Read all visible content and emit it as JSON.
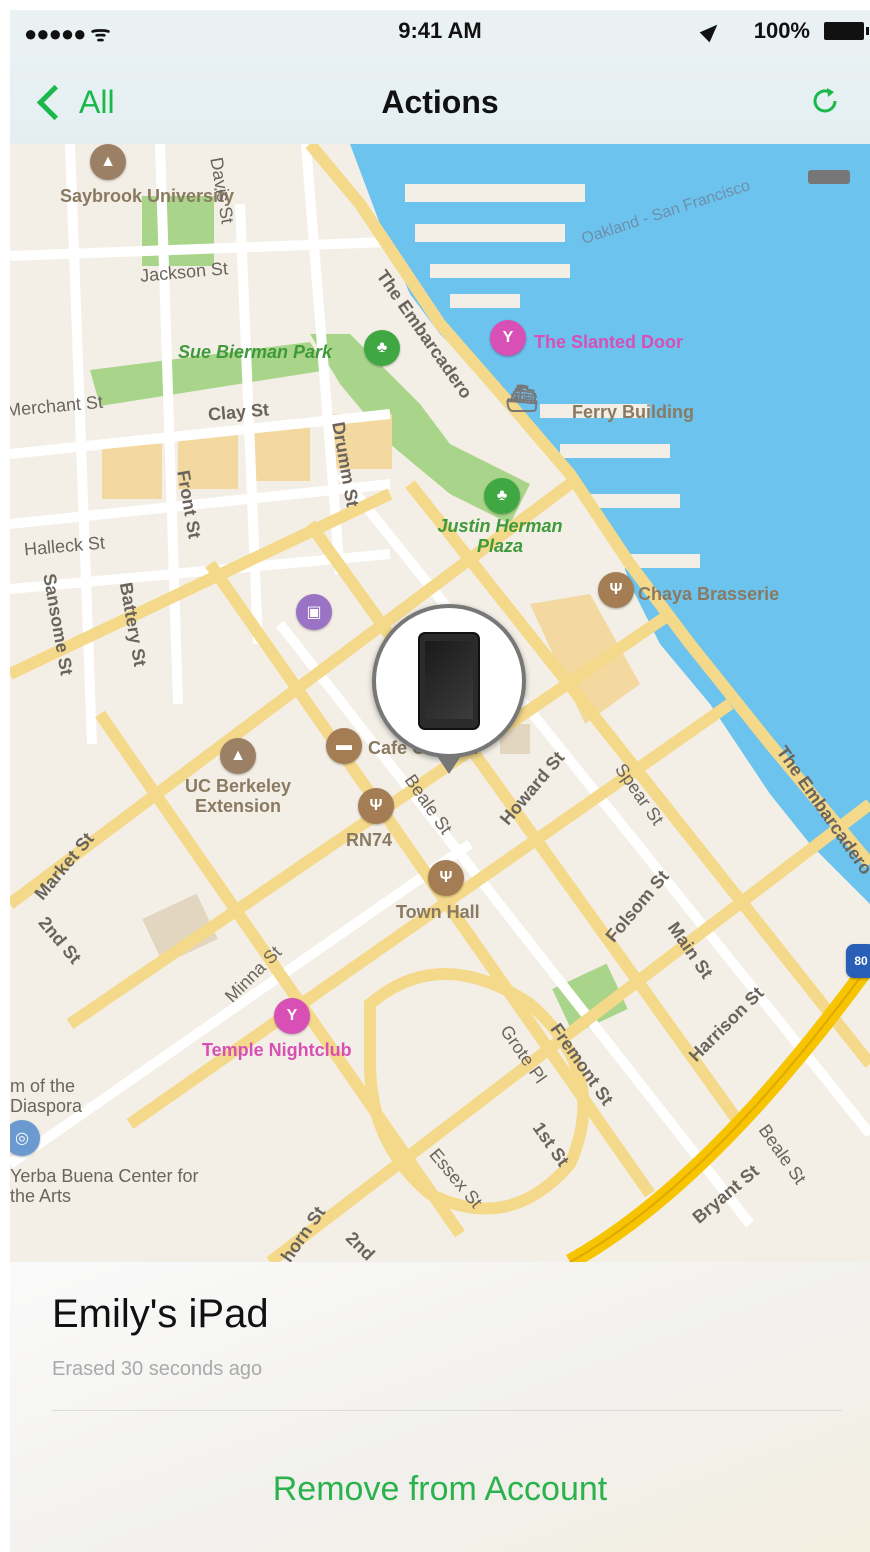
{
  "status_bar": {
    "signal": "●●●●● ᯤ",
    "time": "9:41 AM",
    "battery": "100%"
  },
  "nav": {
    "back_label": "All",
    "title": "Actions"
  },
  "map": {
    "labels": {
      "saybrook": "Saybrook University",
      "jackson": "Jackson St",
      "davis": "Davis St",
      "embarcadero1": "The Embarcadero",
      "oakland": "Oakland - San Francisco",
      "sue_bierman": "Sue Bierman Park",
      "slanted_door": "The Slanted Door",
      "merchant": "Merchant St",
      "clay": "Clay St",
      "ferry": "Ferry Building",
      "front": "Front St",
      "drumm": "Drumm St",
      "justin": "Justin Herman Plaza",
      "halleck": "Halleck St",
      "sansome": "Sansome St",
      "battery": "Battery St",
      "chaya": "Chaya Brasserie",
      "cafe": "Cafe Claudia",
      "uc_berkeley": "UC Berkeley Extension",
      "beale1": "Beale St",
      "howard": "Howard St",
      "spear": "Spear St",
      "embarcadero2": "The Embarcadero",
      "rn74": "RN74",
      "market": "Market St",
      "town_hall": "Town Hall",
      "folsom": "Folsom St",
      "main": "Main St",
      "second": "2nd St",
      "minna": "Minna St",
      "temple": "Temple Nightclub",
      "fremont": "Fremont St",
      "harrison": "Harrison St",
      "diaspora": "m of the Diaspora",
      "first": "1st St",
      "yerba": "Yerba Buena Center for the Arts",
      "essex": "Essex St",
      "bryant": "Bryant St",
      "beale2": "Beale St",
      "second2": "2nd",
      "hawthorne": "horn St",
      "grote": "Grote Pl"
    }
  },
  "device": {
    "name": "Emily's iPad",
    "status": "Erased 30 seconds ago"
  },
  "actions": {
    "remove_label": "Remove from Account"
  },
  "colors": {
    "accent": "#2bb24c",
    "water": "#6cc3ee",
    "park": "#a9d58a",
    "road": "#f5d98a"
  },
  "icons": [
    "back-chevron-icon",
    "refresh-icon",
    "ipad-icon",
    "park-icon",
    "bar-icon",
    "restaurant-icon",
    "school-icon",
    "transit-icon",
    "museum-icon",
    "ferry-icon",
    "highway-shield-icon"
  ]
}
